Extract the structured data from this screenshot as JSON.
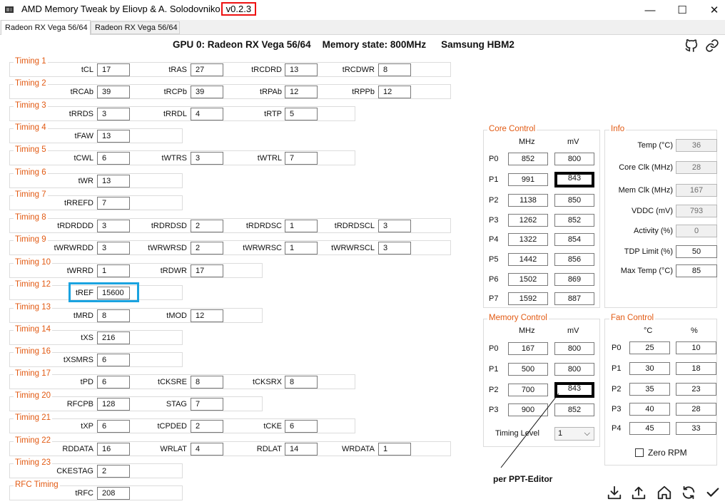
{
  "window": {
    "title_prefix": "AMD Memory Tweak by Eliovp & A. Solodovniko",
    "version": "v0.2.3",
    "controls": {
      "minimize": "—",
      "maximize": "☐",
      "close": "✕"
    }
  },
  "tabs": [
    {
      "label": "Radeon RX Vega 56/64",
      "active": true
    },
    {
      "label": "Radeon RX Vega 56/64",
      "active": false
    }
  ],
  "header": {
    "gpu": "GPU 0: Radeon RX Vega 56/64",
    "memory_state": "Memory state: 800MHz",
    "memory_type": "Samsung HBM2"
  },
  "timings": [
    {
      "title": "Timing 1",
      "fields": [
        {
          "label": "tCL",
          "value": "17"
        },
        {
          "label": "tRAS",
          "value": "27"
        },
        {
          "label": "tRCDRD",
          "value": "13"
        },
        {
          "label": "tRCDWR",
          "value": "8"
        }
      ]
    },
    {
      "title": "Timing 2",
      "fields": [
        {
          "label": "tRCAb",
          "value": "39"
        },
        {
          "label": "tRCPb",
          "value": "39"
        },
        {
          "label": "tRPAb",
          "value": "12"
        },
        {
          "label": "tRPPb",
          "value": "12"
        }
      ]
    },
    {
      "title": "Timing 3",
      "fields": [
        {
          "label": "tRRDS",
          "value": "3"
        },
        {
          "label": "tRRDL",
          "value": "4"
        },
        {
          "label": "tRTP",
          "value": "5"
        }
      ]
    },
    {
      "title": "Timing 4",
      "fields": [
        {
          "label": "tFAW",
          "value": "13"
        }
      ]
    },
    {
      "title": "Timing 5",
      "fields": [
        {
          "label": "tCWL",
          "value": "6"
        },
        {
          "label": "tWTRS",
          "value": "3"
        },
        {
          "label": "tWTRL",
          "value": "7"
        }
      ]
    },
    {
      "title": "Timing 6",
      "fields": [
        {
          "label": "tWR",
          "value": "13"
        }
      ]
    },
    {
      "title": "Timing 7",
      "fields": [
        {
          "label": "tRREFD",
          "value": "7"
        }
      ]
    },
    {
      "title": "Timing 8",
      "fields": [
        {
          "label": "tRDRDDD",
          "value": "3"
        },
        {
          "label": "tRDRDSD",
          "value": "2"
        },
        {
          "label": "tRDRDSC",
          "value": "1"
        },
        {
          "label": "tRDRDSCL",
          "value": "3"
        }
      ]
    },
    {
      "title": "Timing 9",
      "fields": [
        {
          "label": "tWRWRDD",
          "value": "3"
        },
        {
          "label": "tWRWRSD",
          "value": "2"
        },
        {
          "label": "tWRWRSC",
          "value": "1"
        },
        {
          "label": "tWRWRSCL",
          "value": "3"
        }
      ]
    },
    {
      "title": "Timing 10",
      "fields": [
        {
          "label": "tWRRD",
          "value": "1"
        },
        {
          "label": "tRDWR",
          "value": "17"
        }
      ]
    },
    {
      "title": "Timing 12",
      "fields": [
        {
          "label": "tREF",
          "value": "15600"
        }
      ]
    },
    {
      "title": "Timing 13",
      "fields": [
        {
          "label": "tMRD",
          "value": "8"
        },
        {
          "label": "tMOD",
          "value": "12"
        }
      ]
    },
    {
      "title": "Timing 14",
      "fields": [
        {
          "label": "tXS",
          "value": "216"
        }
      ]
    },
    {
      "title": "Timing 16",
      "fields": [
        {
          "label": "tXSMRS",
          "value": "6"
        }
      ]
    },
    {
      "title": "Timing 17",
      "fields": [
        {
          "label": "tPD",
          "value": "6"
        },
        {
          "label": "tCKSRE",
          "value": "8"
        },
        {
          "label": "tCKSRX",
          "value": "8"
        }
      ]
    },
    {
      "title": "Timing 20",
      "fields": [
        {
          "label": "RFCPB",
          "value": "128"
        },
        {
          "label": "STAG",
          "value": "7"
        }
      ]
    },
    {
      "title": "Timing 21",
      "fields": [
        {
          "label": "tXP",
          "value": "6"
        },
        {
          "label": "tCPDED",
          "value": "2"
        },
        {
          "label": "tCKE",
          "value": "6"
        }
      ]
    },
    {
      "title": "Timing 22",
      "fields": [
        {
          "label": "RDDATA",
          "value": "16"
        },
        {
          "label": "WRLAT",
          "value": "4"
        },
        {
          "label": "RDLAT",
          "value": "14"
        },
        {
          "label": "WRDATA",
          "value": "1"
        }
      ]
    },
    {
      "title": "Timing 23",
      "fields": [
        {
          "label": "CKESTAG",
          "value": "2"
        }
      ]
    },
    {
      "title": "RFC Timing",
      "fields": [
        {
          "label": "tRFC",
          "value": "208"
        }
      ]
    }
  ],
  "core_control": {
    "title": "Core Control",
    "col_mhz": "MHz",
    "col_mv": "mV",
    "rows": [
      {
        "p": "P0",
        "mhz": "852",
        "mv": "800"
      },
      {
        "p": "P1",
        "mhz": "991",
        "mv": "843"
      },
      {
        "p": "P2",
        "mhz": "1138",
        "mv": "850"
      },
      {
        "p": "P3",
        "mhz": "1262",
        "mv": "852"
      },
      {
        "p": "P4",
        "mhz": "1322",
        "mv": "854"
      },
      {
        "p": "P5",
        "mhz": "1442",
        "mv": "856"
      },
      {
        "p": "P6",
        "mhz": "1502",
        "mv": "869"
      },
      {
        "p": "P7",
        "mhz": "1592",
        "mv": "887"
      }
    ]
  },
  "memory_control": {
    "title": "Memory Control",
    "col_mhz": "MHz",
    "col_mv": "mV",
    "rows": [
      {
        "p": "P0",
        "mhz": "167",
        "mv": "800"
      },
      {
        "p": "P1",
        "mhz": "500",
        "mv": "800"
      },
      {
        "p": "P2",
        "mhz": "700",
        "mv": "843"
      },
      {
        "p": "P3",
        "mhz": "900",
        "mv": "852"
      }
    ],
    "timing_level_label": "Timing Level",
    "timing_level_value": "1"
  },
  "info": {
    "title": "Info",
    "rows": [
      {
        "label": "Temp (°C)",
        "value": "36",
        "readonly": true
      },
      {
        "label": "Core Clk (MHz)",
        "value": "28",
        "readonly": true
      },
      {
        "label": "Mem Clk (MHz)",
        "value": "167",
        "readonly": true
      },
      {
        "label": "VDDC (mV)",
        "value": "793",
        "readonly": true
      },
      {
        "label": "Activity (%)",
        "value": "0",
        "readonly": true
      },
      {
        "label": "TDP Limit (%)",
        "value": "50",
        "readonly": false
      },
      {
        "label": "Max Temp (°C)",
        "value": "85",
        "readonly": false
      }
    ]
  },
  "fan_control": {
    "title": "Fan Control",
    "col_c": "°C",
    "col_pct": "%",
    "rows": [
      {
        "p": "P0",
        "c": "25",
        "pct": "10"
      },
      {
        "p": "P1",
        "c": "30",
        "pct": "18"
      },
      {
        "p": "P2",
        "c": "35",
        "pct": "23"
      },
      {
        "p": "P3",
        "c": "40",
        "pct": "28"
      },
      {
        "p": "P4",
        "c": "45",
        "pct": "33"
      }
    ],
    "zero_rpm_label": "Zero RPM",
    "zero_rpm_checked": false
  },
  "annotation": "per PPT-Editor",
  "colors": {
    "group_label": "#e25a13",
    "version_box": "#e11111",
    "tref_highlight": "#1aa3e0",
    "mv_highlight": "#000000"
  },
  "toolbar_icons": [
    "download-icon",
    "upload-icon",
    "home-icon",
    "refresh-icon",
    "apply-check-icon"
  ]
}
